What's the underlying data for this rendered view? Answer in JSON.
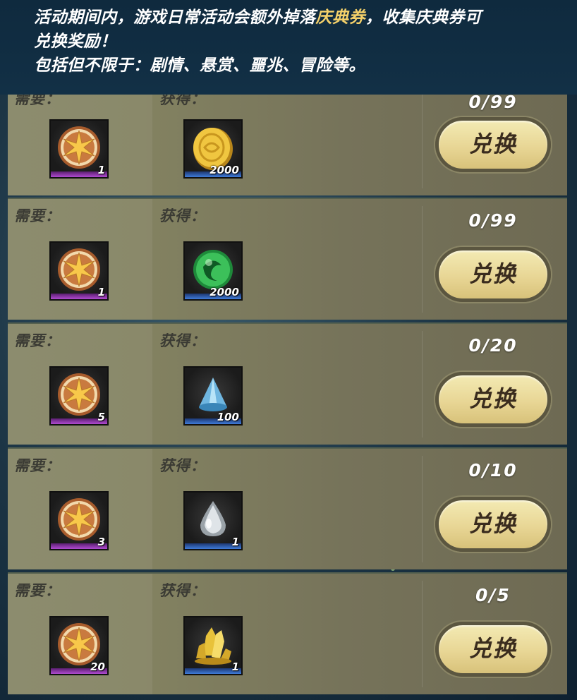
{
  "header": {
    "line1_a": "活动期间内，游戏日常活动会额外掉落",
    "line1_highlight": "庆典券",
    "line1_b": "，收集庆典券可",
    "line2": "兑换奖励！",
    "line3": "包括但不限于：剧情、悬赏、噩兆、冒险等。"
  },
  "rows": [
    {
      "need_label": "需要：",
      "get_label": "获得：",
      "need_icon": "star-medal-icon",
      "need_qty": "1",
      "get_icon": "gold-coin-icon",
      "get_qty": "2000",
      "count": "0/99",
      "button": "兑换"
    },
    {
      "need_label": "需要：",
      "get_label": "获得：",
      "need_icon": "star-medal-icon",
      "need_qty": "1",
      "get_icon": "green-orb-icon",
      "get_qty": "2000",
      "count": "0/99",
      "button": "兑换"
    },
    {
      "need_label": "需要：",
      "get_label": "获得：",
      "need_icon": "star-medal-icon",
      "need_qty": "5",
      "get_icon": "blue-crystal-cone-icon",
      "get_qty": "100",
      "count": "0/20",
      "button": "兑换"
    },
    {
      "need_label": "需要：",
      "get_label": "获得：",
      "need_icon": "star-medal-icon",
      "need_qty": "3",
      "get_icon": "silver-drop-icon",
      "get_qty": "1",
      "count": "0/10",
      "button": "兑换"
    },
    {
      "need_label": "需要：",
      "get_label": "获得：",
      "need_icon": "star-medal-icon",
      "need_qty": "20",
      "get_icon": "gold-crystal-icon",
      "get_qty": "1",
      "count": "0/5",
      "button": "兑换"
    }
  ]
}
